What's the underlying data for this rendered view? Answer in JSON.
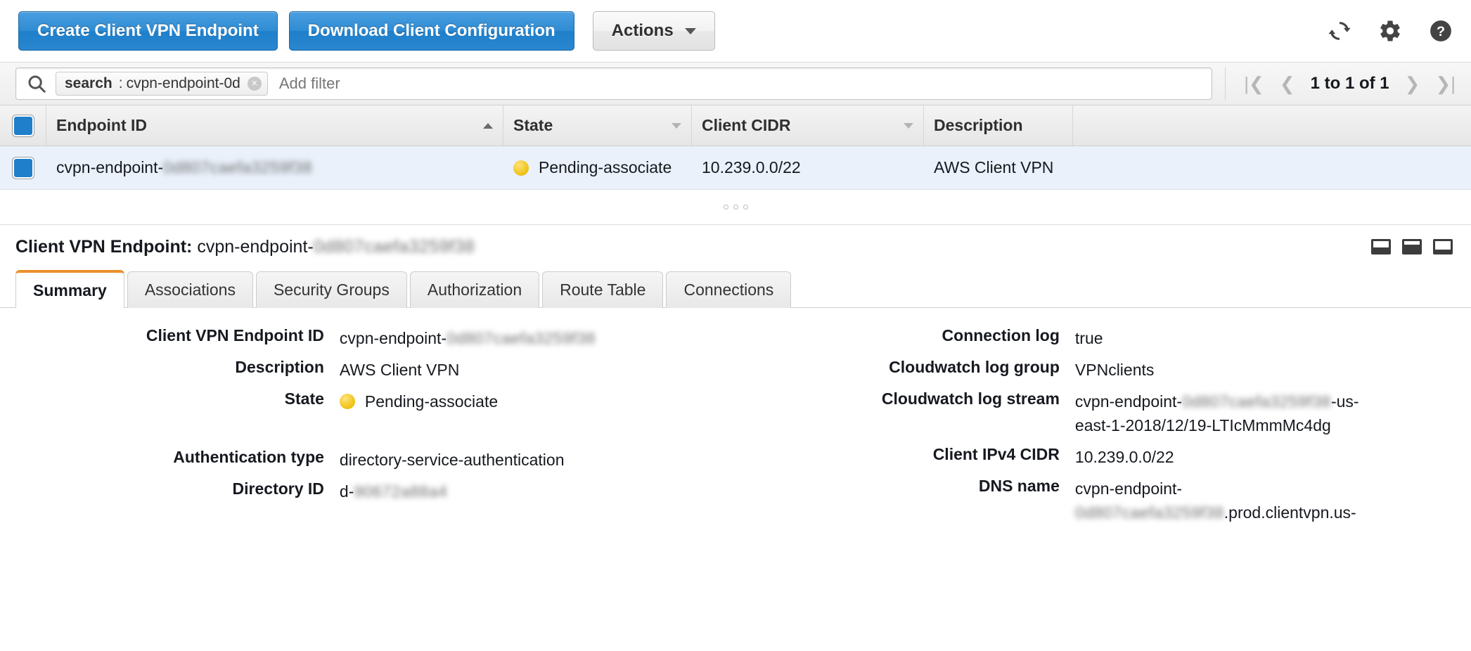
{
  "toolbar": {
    "create_button": "Create Client VPN Endpoint",
    "download_button": "Download Client Configuration",
    "actions_button": "Actions",
    "icons": {
      "refresh": "refresh-icon",
      "settings": "gear-icon",
      "help": "help-icon"
    }
  },
  "filterbar": {
    "search_token_key": "search",
    "search_token_sep": ":",
    "search_token_value": "cvpn-endpoint-0d",
    "clear_token": "×",
    "add_filter_placeholder": "Add filter",
    "pagination": {
      "first": "|❮",
      "prev": "❮",
      "count": "1 to 1 of 1",
      "next": "❯",
      "last": "❯|"
    }
  },
  "table": {
    "columns": [
      {
        "label": "Endpoint ID",
        "sort": "asc"
      },
      {
        "label": "State",
        "sort": "desc"
      },
      {
        "label": "Client CIDR",
        "sort": "desc"
      },
      {
        "label": "Description",
        "sort": "desc"
      }
    ],
    "rows": [
      {
        "selected": true,
        "endpoint_id_prefix": "cvpn-endpoint-",
        "endpoint_id_redacted": "0d807caefa3259f38",
        "state": "Pending-associate",
        "state_color": "#f0c419",
        "client_cidr": "10.239.0.0/22",
        "description": "AWS Client VPN"
      }
    ]
  },
  "detail": {
    "title_label": "Client VPN Endpoint:",
    "title_value_prefix": "cvpn-endpoint-",
    "title_value_redacted": "0d807caefa3259f38",
    "panel_icons": [
      "panel-bottom-icon",
      "panel-split-icon",
      "panel-top-icon"
    ],
    "tabs": [
      {
        "label": "Summary",
        "active": true
      },
      {
        "label": "Associations",
        "active": false
      },
      {
        "label": "Security Groups",
        "active": false
      },
      {
        "label": "Authorization",
        "active": false
      },
      {
        "label": "Route Table",
        "active": false
      },
      {
        "label": "Connections",
        "active": false
      }
    ],
    "left_fields": [
      {
        "label": "Client VPN Endpoint ID",
        "value_prefix": "cvpn-endpoint-",
        "value_redacted": "0d807caefa3259f38"
      },
      {
        "label": "Description",
        "value": "AWS Client VPN"
      },
      {
        "label": "State",
        "value": "Pending-associate",
        "status": true
      }
    ],
    "left_fields_2": [
      {
        "label": "Authentication type",
        "value": "directory-service-authentication"
      },
      {
        "label": "Directory ID",
        "value_prefix": "d-",
        "value_redacted": "90672a88a4"
      }
    ],
    "right_fields": [
      {
        "label": "Connection log",
        "value": "true"
      },
      {
        "label": "Cloudwatch log group",
        "value": "VPNclients"
      },
      {
        "label": "Cloudwatch log stream",
        "value_prefix": "cvpn-endpoint-",
        "value_redacted": "0d807caefa3259f38",
        "value_suffix": "-us-east-1-2018/12/19-LTIcMmmMc4dg"
      }
    ],
    "right_fields_2": [
      {
        "label": "Client IPv4 CIDR",
        "value": "10.239.0.0/22"
      },
      {
        "label": "DNS name",
        "value_prefix": "cvpn-endpoint-",
        "value_redacted": "0d807caefa3259f38",
        "value_suffix": ".prod.clientvpn.us-"
      }
    ]
  }
}
